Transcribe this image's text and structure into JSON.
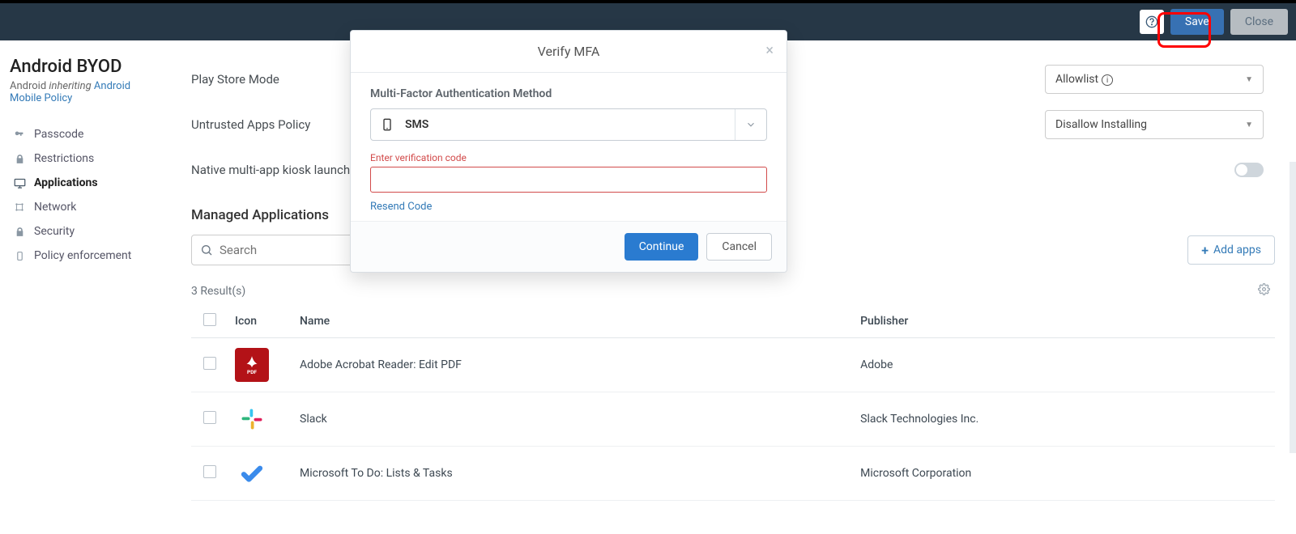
{
  "topbar": {
    "save": "Save",
    "close": "Close"
  },
  "page": {
    "title": "Android BYOD",
    "platform": "Android",
    "inheriting": "inheriting",
    "policy_link": "Android Mobile Policy"
  },
  "sidebar": {
    "items": [
      {
        "label": "Passcode"
      },
      {
        "label": "Restrictions"
      },
      {
        "label": "Applications"
      },
      {
        "label": "Network"
      },
      {
        "label": "Security"
      },
      {
        "label": "Policy enforcement"
      }
    ]
  },
  "settings": {
    "play_store_mode": {
      "label": "Play Store Mode",
      "value": "Allowlist"
    },
    "untrusted_apps": {
      "label": "Untrusted Apps Policy",
      "value": "Disallow Installing"
    },
    "kiosk": {
      "label": "Native multi-app kiosk launcher"
    }
  },
  "managed_apps": {
    "title": "Managed Applications",
    "search_placeholder": "Search",
    "add_apps": "Add apps",
    "results_text": "3 Result(s)",
    "columns": {
      "icon": "Icon",
      "name": "Name",
      "publisher": "Publisher"
    },
    "rows": [
      {
        "name": "Adobe Acrobat Reader: Edit PDF",
        "publisher": "Adobe"
      },
      {
        "name": "Slack",
        "publisher": "Slack Technologies Inc."
      },
      {
        "name": "Microsoft To Do: Lists & Tasks",
        "publisher": "Microsoft Corporation"
      }
    ]
  },
  "modal": {
    "title": "Verify MFA",
    "method_label": "Multi-Factor Authentication Method",
    "method_value": "SMS",
    "code_label": "Enter verification code",
    "resend": "Resend Code",
    "continue": "Continue",
    "cancel": "Cancel"
  }
}
